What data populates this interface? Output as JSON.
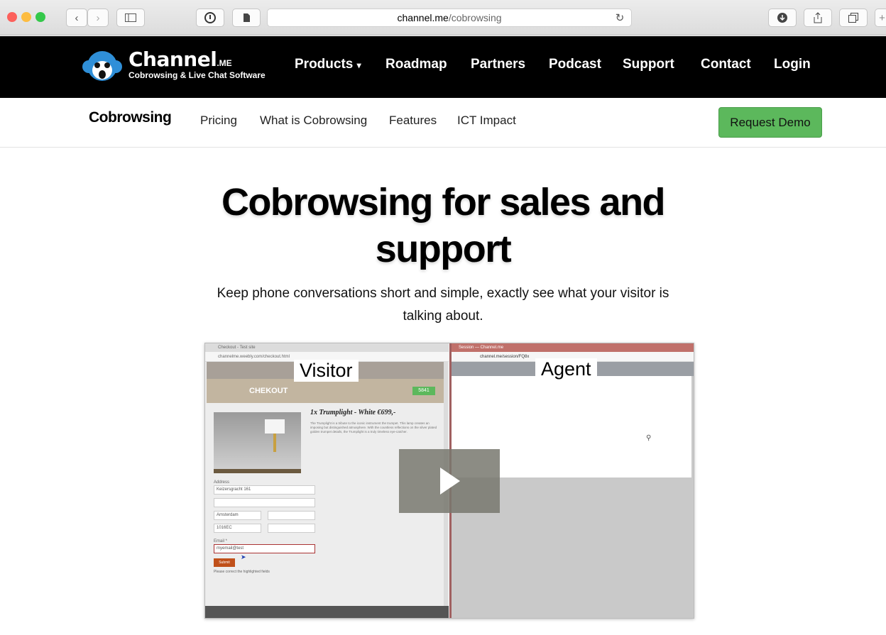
{
  "browser": {
    "url_host": "channel.me",
    "url_path": "/cobrowsing",
    "colors": {
      "close": "#fc605b",
      "minimize": "#fdbc40",
      "zoom": "#34c84a"
    }
  },
  "nav": {
    "logo": {
      "name": "Channel",
      "suffix": ".ME",
      "tagline": "Cobrowsing & Live Chat Software"
    },
    "items": [
      "Products",
      "Roadmap",
      "Partners",
      "Podcast",
      "Support",
      "Contact",
      "Login"
    ]
  },
  "subnav": {
    "brand": "Cobrowsing",
    "items": [
      "Pricing",
      "What is Cobrowsing",
      "Features",
      "ICT Impact"
    ],
    "cta": "Request Demo"
  },
  "hero": {
    "title": "Cobrowsing for sales and support",
    "subtitle": "Keep phone conversations short and simple, exactly see what your visitor is talking about."
  },
  "video": {
    "visitor_label": "Visitor",
    "agent_label": "Agent",
    "checkout_title": "CHEKOUT",
    "checkout_badge": "5841",
    "product_title": "1x Trumplight - White €699,-",
    "product_desc": "The Trumplight is a tribute to the iconic instrument the trumpet. This lamp creates an imposing but distinguished atmosphere. With the countless reflections on the silver plated golden trumpet details, the Trumplight is a truly timeless eye-catcher.",
    "address_label": "Address",
    "address_line1": "Keizersgracht 161",
    "city": "Amsterdam",
    "zip": "1016EC",
    "email_label": "Email *",
    "email_value": "myemail@test",
    "submit": "Submit",
    "error": "Please correct the highlighted fields",
    "visitor_tab": "Checkout - Test site",
    "visitor_url": "channelme.weebly.com/checkout.html",
    "agent_tab": "Session — Channel.me",
    "agent_url": "channel.me/session/FQ8x"
  }
}
